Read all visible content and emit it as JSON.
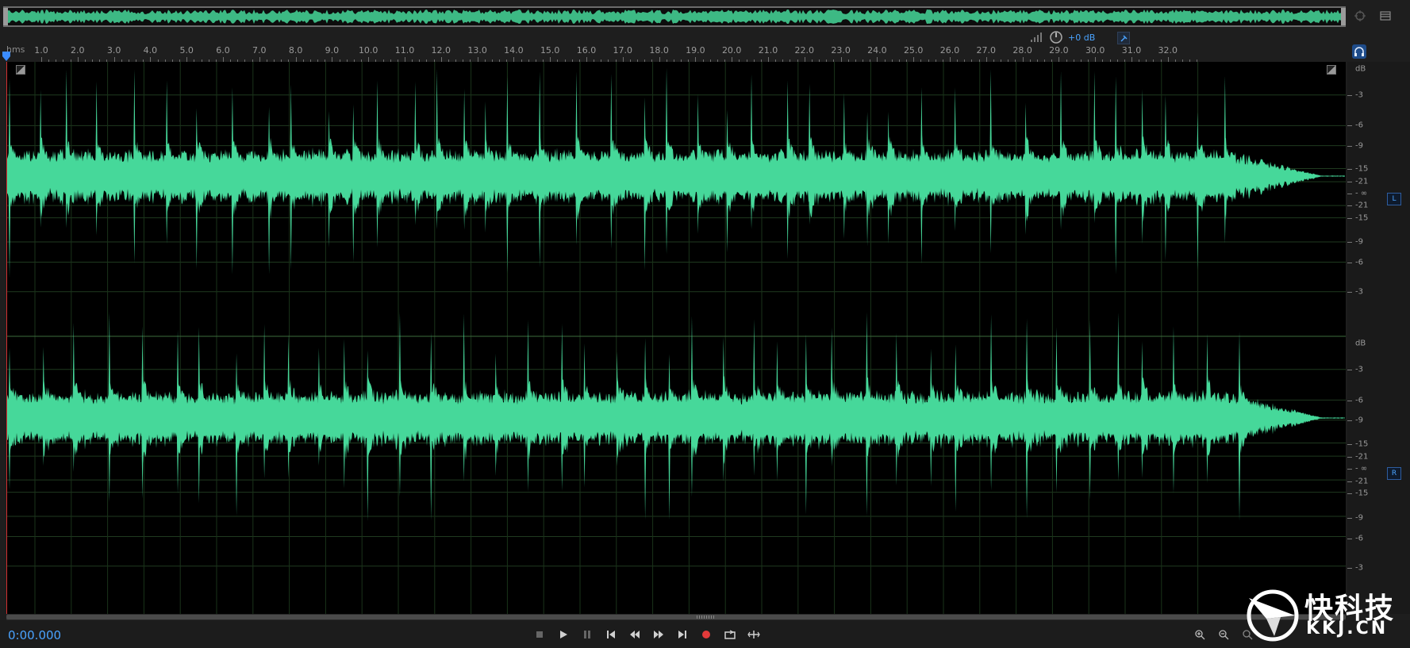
{
  "overview": {
    "label": "overview-waveform"
  },
  "ruler": {
    "unit": "hms",
    "ticks": [
      "1.0",
      "2.0",
      "3.0",
      "4.0",
      "5.0",
      "6.0",
      "7.0",
      "8.0",
      "9.0",
      "10.0",
      "11.0",
      "12.0",
      "13.0",
      "14.0",
      "15.0",
      "16.0",
      "17.0",
      "18.0",
      "19.0",
      "20.0",
      "21.0",
      "22.0",
      "23.0",
      "24.0",
      "25.0",
      "26.0",
      "27.0",
      "28.0",
      "29.0",
      "30.0",
      "31.0",
      "32.0"
    ]
  },
  "hud": {
    "volume": "+0 dB"
  },
  "db_scale": {
    "unit": "dB",
    "labels": [
      "-3",
      "-6",
      "-9",
      "-15",
      "-21",
      "- ∞",
      "-21",
      "-15",
      "-9",
      "-6",
      "-3"
    ],
    "left_channel": "L",
    "right_channel": "R"
  },
  "transport": {
    "time": "0:00.000",
    "buttons": [
      "stop",
      "play",
      "pause",
      "go-to-start",
      "rewind",
      "fast-forward",
      "go-to-end",
      "record",
      "loop",
      "skip-selection"
    ]
  },
  "watermark": {
    "cn": "快科技",
    "en": "KKJ.CN"
  },
  "colors": {
    "waveform": "#46d89a",
    "accent": "#4aa3ff",
    "record": "#e23a3a",
    "background": "#000000"
  }
}
